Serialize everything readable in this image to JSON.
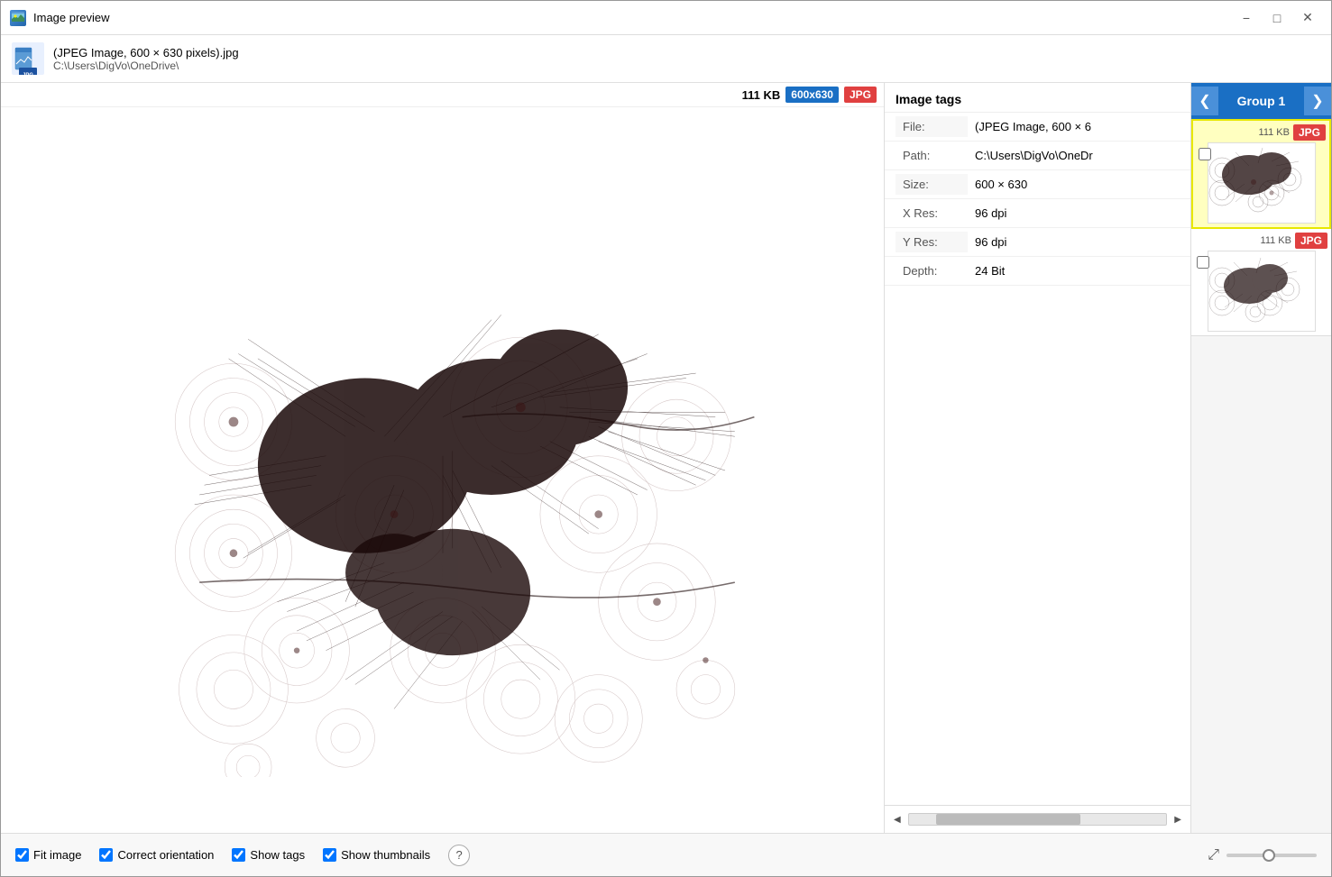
{
  "window": {
    "title": "Image preview",
    "icon_label": "image-preview-icon"
  },
  "titlebar": {
    "minimize_label": "−",
    "maximize_label": "□",
    "close_label": "✕"
  },
  "file_header": {
    "filename": "(JPEG Image, 600 × 630 pixels).jpg",
    "path": "C:\\Users\\DigVo\\OneDrive\\",
    "size_text": "111 KB",
    "dimensions_badge": "600x630",
    "format_badge": "JPG"
  },
  "image_tags": {
    "header": "Image tags",
    "rows": [
      {
        "label": "File:",
        "value": "(JPEG Image, 600 × 6"
      },
      {
        "label": "Path:",
        "value": "C:\\Users\\DigVo\\OneDr"
      },
      {
        "label": "Size:",
        "value": "600 × 630"
      },
      {
        "label": "X Res:",
        "value": "96 dpi"
      },
      {
        "label": "Y Res:",
        "value": "96 dpi"
      },
      {
        "label": "Depth:",
        "value": "24 Bit"
      }
    ]
  },
  "group_nav": {
    "label": "Group 1",
    "prev_label": "❮",
    "next_label": "❯"
  },
  "thumbnails": [
    {
      "size": "111 KB",
      "format": "JPG",
      "selected": true
    },
    {
      "size": "111 KB",
      "format": "JPG",
      "selected": false
    }
  ],
  "bottom_bar": {
    "fit_image_label": "Fit image",
    "correct_orientation_label": "Correct orientation",
    "show_tags_label": "Show tags",
    "show_thumbnails_label": "Show thumbnails",
    "help_label": "?"
  }
}
